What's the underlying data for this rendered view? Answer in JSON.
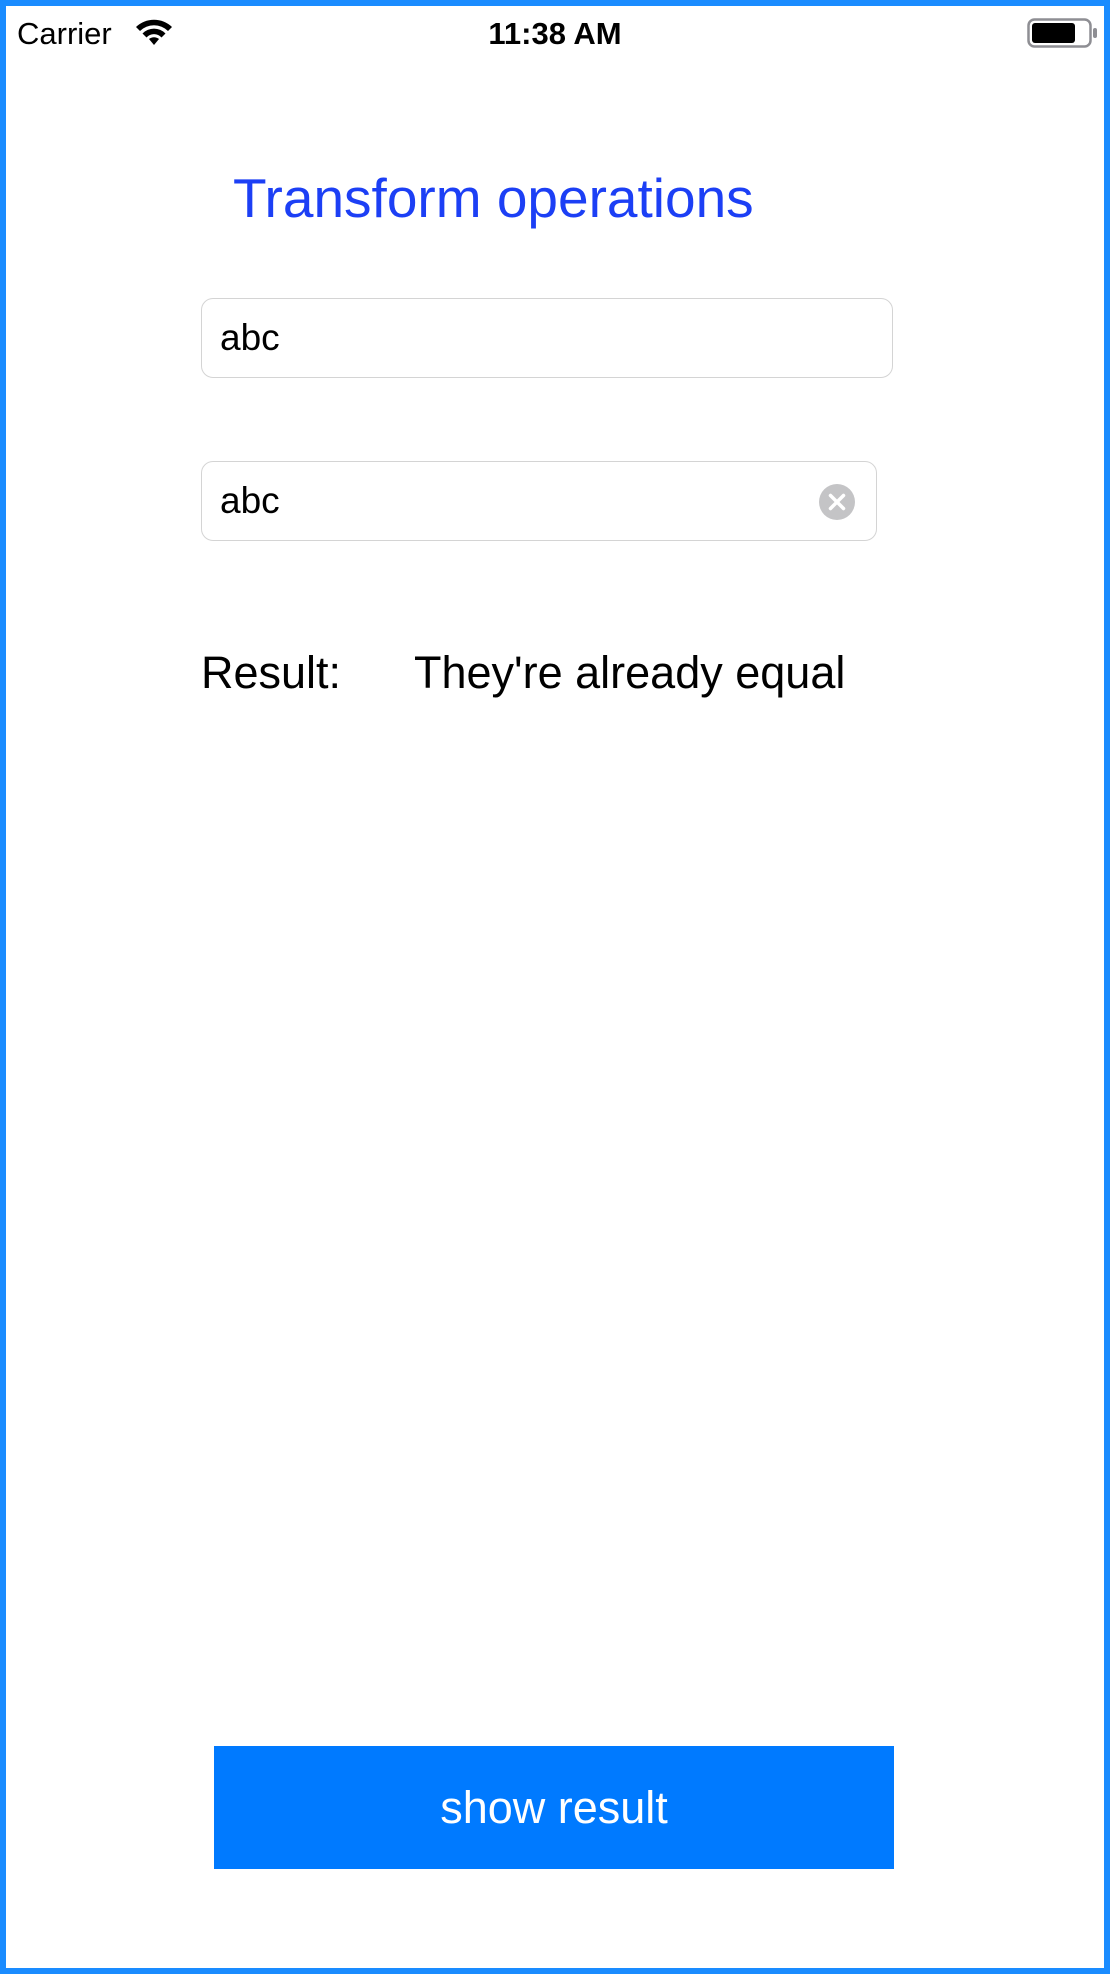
{
  "status_bar": {
    "carrier": "Carrier",
    "time": "11:38 AM",
    "wifi_icon": "wifi-icon",
    "battery_icon": "battery-icon"
  },
  "header": {
    "title": "Transform operations",
    "title_color": "#1c3ff5"
  },
  "form": {
    "field1_value": "abc",
    "field2_value": "abc",
    "clear_icon": "clear-circle-icon"
  },
  "result": {
    "label": "Result:",
    "value": "They're already equal"
  },
  "actions": {
    "show_result_label": "show result",
    "button_color": "#007aff"
  },
  "frame_color": "#1a8cff"
}
